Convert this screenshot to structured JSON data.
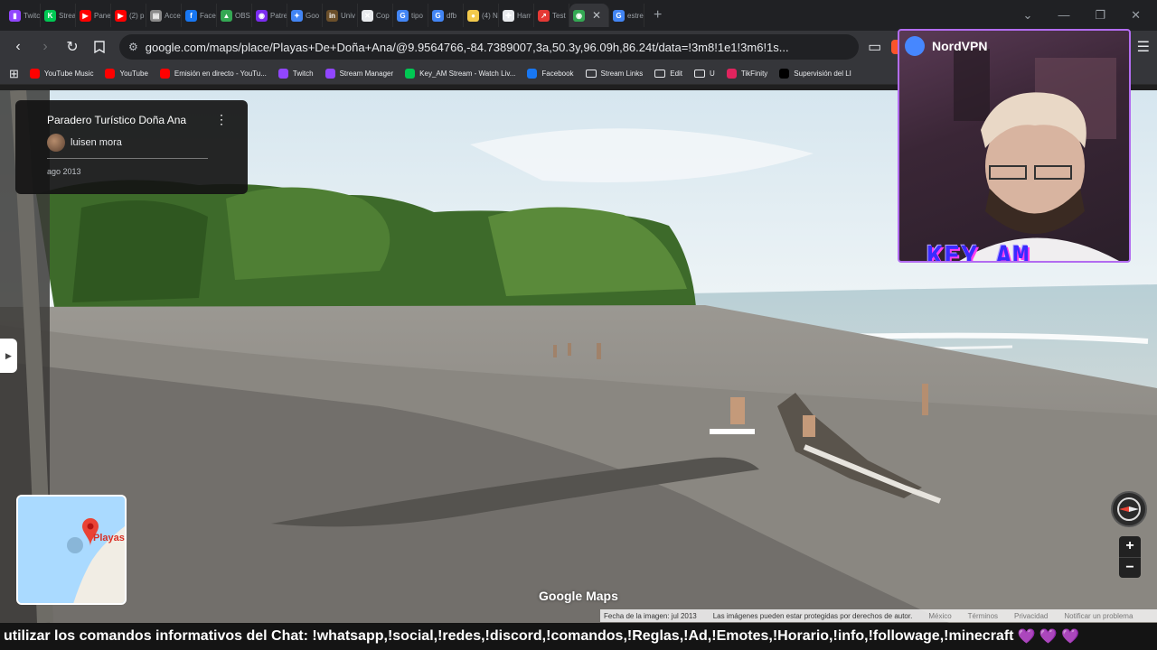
{
  "tabs": [
    {
      "label": "Twitch",
      "color": "#9146ff",
      "glyph": "▮"
    },
    {
      "label": "Stream",
      "color": "#00c853",
      "glyph": "K"
    },
    {
      "label": "Panel",
      "color": "#ff0000",
      "glyph": "▶"
    },
    {
      "label": "(2) p",
      "color": "#ff0000",
      "glyph": "▶"
    },
    {
      "label": "Acce",
      "color": "#8a8a8a",
      "glyph": "▤"
    },
    {
      "label": "Face",
      "color": "#1877f2",
      "glyph": "f"
    },
    {
      "label": "OBS",
      "color": "#34a853",
      "glyph": "▲"
    },
    {
      "label": "Patre",
      "color": "#7b2cf0",
      "glyph": "◉"
    },
    {
      "label": "Goo",
      "color": "#4285f4",
      "glyph": "✦"
    },
    {
      "label": "Univ",
      "color": "#6b4f2a",
      "glyph": "in"
    },
    {
      "label": "Cop",
      "color": "#e8eaed",
      "glyph": "✕"
    },
    {
      "label": "tipo",
      "color": "#4285f4",
      "glyph": "G"
    },
    {
      "label": "dfb",
      "color": "#4285f4",
      "glyph": "G"
    },
    {
      "label": "(4) N",
      "color": "#f2c94c",
      "glyph": "●"
    },
    {
      "label": "Harr",
      "color": "#e8eaed",
      "glyph": "✚"
    },
    {
      "label": "Test",
      "color": "#e53935",
      "glyph": "↗"
    },
    {
      "label": "",
      "color": "#34a853",
      "glyph": "◉",
      "active": true
    },
    {
      "label": "estre",
      "color": "#4285f4",
      "glyph": "G"
    }
  ],
  "address": {
    "url": "google.com/maps/place/Playas+De+Doña+Ana/@9.9564766,-84.7389007,3a,50.3y,96.09h,86.24t/data=!3m8!1e1!3m6!1s..."
  },
  "bookmarks": [
    {
      "label": "YouTube Music",
      "color": "#ff0000"
    },
    {
      "label": "YouTube",
      "color": "#ff0000"
    },
    {
      "label": "Emisión en directo - YouTu...",
      "color": "#ff0000"
    },
    {
      "label": "Twitch",
      "color": "#9146ff"
    },
    {
      "label": "Stream Manager",
      "color": "#9146ff"
    },
    {
      "label": "Key_AM Stream - Watch Liv...",
      "color": "#00c853"
    },
    {
      "label": "Facebook",
      "color": "#1877f2"
    },
    {
      "label": "Stream Links",
      "folder": true
    },
    {
      "label": "Edit",
      "folder": true
    },
    {
      "label": "U",
      "folder": true
    },
    {
      "label": "TikFinity",
      "color": "#e0245e"
    },
    {
      "label": "Supervisión del LI",
      "color": "#000000"
    }
  ],
  "infocard": {
    "place": "Paradero Turístico Doña Ana",
    "author": "luisen mora",
    "date": "ago 2013"
  },
  "minimap": {
    "label": "Playas"
  },
  "maps": {
    "logo": "Google Maps",
    "footer": {
      "image_date": "Fecha de la imagen: jul 2013",
      "copyright": "Las imágenes pueden estar protegidas por derechos de autor.",
      "country": "México",
      "terms": "Términos",
      "privacy": "Privacidad",
      "report": "Notificar un problema"
    }
  },
  "webcam": {
    "vpn_label": "NordVPN",
    "tag": "KEY_AM"
  },
  "ticker": {
    "text": "utilizar los comandos informativos del Chat: !whatsapp,!social,!redes,!discord,!comandos,!Reglas,!Ad,!Emotes,!Horario,!info,!followage,!minecraft",
    "hearts": "💜 💜 💜"
  },
  "colors": {
    "accent_purple": "#b26cf0",
    "maps_red": "#d93025"
  }
}
